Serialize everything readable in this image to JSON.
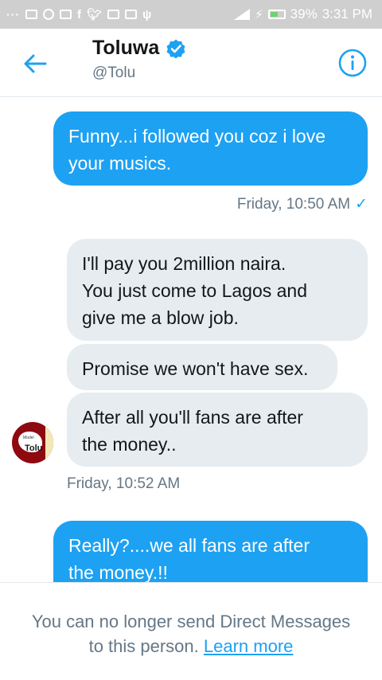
{
  "status_bar": {
    "dots": "···",
    "battery_percent": "39%",
    "time": "3:31 PM",
    "icons": [
      "image-icon",
      "shield-icon",
      "news-icon",
      "facebook-icon",
      "twitter-icon",
      "mail-icon",
      "chat-icon",
      "usb-icon",
      "signal-icon",
      "charging-icon",
      "battery-icon"
    ]
  },
  "header": {
    "display_name": "Toluwa",
    "handle": "@Tolu",
    "verified": true
  },
  "messages": [
    {
      "direction": "sent",
      "text": "Funny...i followed you coz i love your musics.",
      "lines": [
        "Funny...i followed you coz i love",
        "your musics."
      ]
    },
    {
      "direction": "sent-meta",
      "timestamp": "Friday, 10:50 AM",
      "read_mark": "✓"
    },
    {
      "direction": "received",
      "lines": [
        "I'll pay you 2million naira.",
        "You just come to Lagos and",
        "give me a blow job."
      ]
    },
    {
      "direction": "received",
      "lines": [
        "Promise we won't have sex."
      ]
    },
    {
      "direction": "received",
      "lines": [
        "After all you'll fans are after",
        "the money.."
      ]
    },
    {
      "direction": "received-meta",
      "timestamp": "Friday, 10:52 AM"
    },
    {
      "direction": "sent",
      "lines": [
        "Really?....we all fans are after",
        "the money.!!"
      ]
    }
  ],
  "avatar": {
    "label": "Tolu",
    "tiny_label": "Model"
  },
  "footer": {
    "notice_line1": "You can no longer send Direct Messages",
    "notice_line2": "to this person.",
    "link": "Learn more"
  },
  "colors": {
    "accent": "#1da1f2",
    "received_bubble": "#e6ecf0",
    "secondary_text": "#657786",
    "status_bar": "#cfcfcf"
  }
}
